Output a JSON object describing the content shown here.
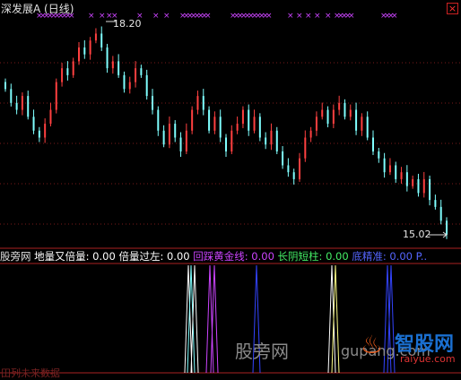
{
  "title": "深发展A (日线)",
  "close_label": "×",
  "high_label": "18.20",
  "low_label": "15.02",
  "indicator": {
    "name": "股旁网",
    "items": [
      {
        "label": "地量又倍量",
        "value": "0.00",
        "color": "#ffffff"
      },
      {
        "label": "倍量过左",
        "value": "0.00",
        "color": "#ffffff"
      },
      {
        "label": "回踩黄金线",
        "value": "0.00",
        "color": "#cc44ff"
      },
      {
        "label": "长阴短柱",
        "value": "0.00",
        "color": "#44ee66"
      },
      {
        "label": "底精准",
        "value": "0.00",
        "color": "#5566ff"
      }
    ],
    "tail": "P.."
  },
  "footer": "田列未来数据",
  "watermark": {
    "left": "股旁网",
    "url": "gupang.com",
    "brand": "智股网",
    "brand_url": "raiyue.com"
  },
  "colors": {
    "up": "#ff4040",
    "down": "#7fffff",
    "grid": "#7a1a1a",
    "signal_marks": "#cc44ff"
  },
  "chart_data": {
    "type": "candlestick",
    "price_high": 18.2,
    "price_low": 15.02,
    "note_candles": "approximate close series read from chart",
    "closes": [
      17.2,
      17.0,
      16.9,
      17.1,
      16.8,
      16.6,
      16.5,
      16.7,
      16.9,
      17.3,
      17.5,
      17.4,
      17.6,
      17.8,
      17.7,
      17.9,
      18.0,
      17.8,
      17.5,
      17.6,
      17.4,
      17.2,
      17.3,
      17.5,
      17.4,
      17.1,
      16.9,
      16.6,
      16.4,
      16.7,
      16.5,
      16.3,
      16.6,
      16.9,
      17.1,
      16.9,
      16.6,
      16.8,
      16.5,
      16.3,
      16.6,
      16.7,
      16.9,
      16.6,
      16.8,
      16.5,
      16.4,
      16.6,
      16.3,
      16.1,
      16.0,
      15.9,
      16.2,
      16.5,
      16.6,
      16.8,
      16.9,
      16.7,
      16.9,
      17.0,
      16.8,
      16.9,
      16.6,
      16.8,
      16.5,
      16.3,
      16.2,
      16.0,
      16.1,
      15.9,
      16.0,
      15.8,
      15.9,
      15.7,
      15.9,
      15.6,
      15.5,
      15.3,
      15.1
    ]
  }
}
